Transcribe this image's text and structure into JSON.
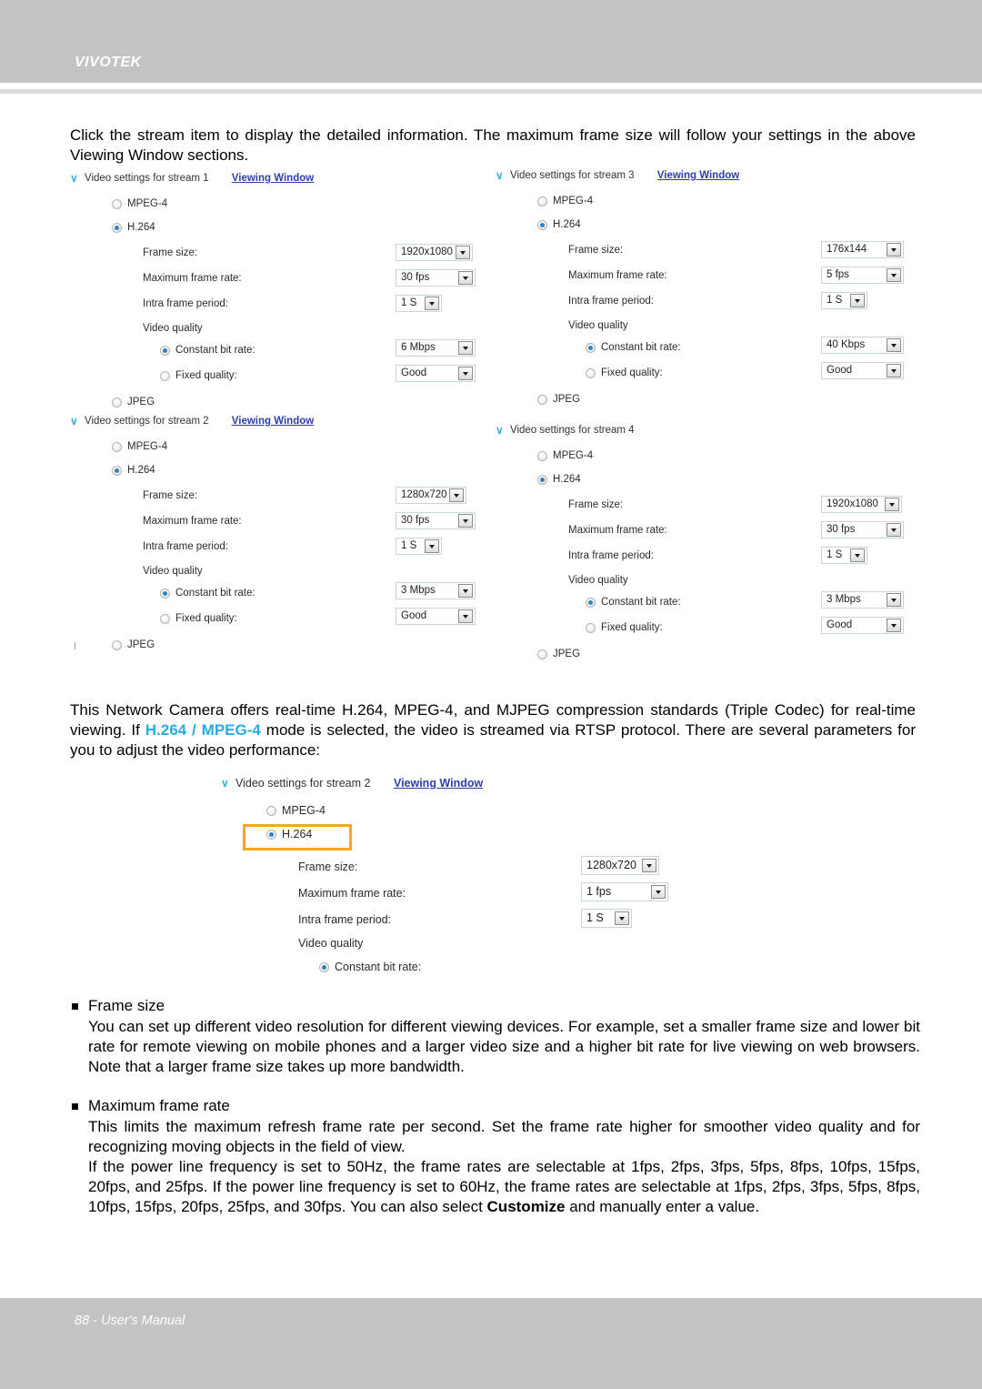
{
  "header": {
    "brand": "VIVOTEK"
  },
  "footer": {
    "page_text": "88 - User's Manual"
  },
  "intro_paragraph": "Click the stream item to display the detailed information. The maximum frame size will follow your settings in the above Viewing Window sections.",
  "codec_paragraph": {
    "part1": "This Network Camera offers real-time H.264, MPEG-4, and MJPEG compression standards (Triple Codec) for real-time viewing.  If ",
    "highlight": "H.264 / MPEG-4",
    "part2": " mode is selected, the video is streamed via RTSP protocol. There are several parameters for you to adjust the video performance:"
  },
  "labels": {
    "viewing_window": "Viewing Window",
    "mpeg4": "MPEG-4",
    "h264": "H.264",
    "jpeg": "JPEG",
    "frame_size": "Frame size:",
    "max_frame_rate": "Maximum frame rate:",
    "intra_frame_period": "Intra frame period:",
    "video_quality": "Video quality",
    "constant_bit_rate": "Constant bit rate:",
    "fixed_quality": "Fixed quality:"
  },
  "streams": [
    {
      "title": "Video settings for stream 1",
      "has_viewing_window": true,
      "frame_size": "1920x1080",
      "max_frame_rate": "30 fps",
      "intra_frame_period": "1 S",
      "constant_bit_rate": "6 Mbps",
      "fixed_quality": "Good"
    },
    {
      "title": "Video settings for stream 3",
      "has_viewing_window": true,
      "frame_size": "176x144",
      "max_frame_rate": "5 fps",
      "intra_frame_period": "1 S",
      "constant_bit_rate": "40 Kbps",
      "fixed_quality": "Good"
    },
    {
      "title": "Video settings for stream 2",
      "has_viewing_window": true,
      "frame_size": "1280x720",
      "max_frame_rate": "30 fps",
      "intra_frame_period": "1 S",
      "constant_bit_rate": "3 Mbps",
      "fixed_quality": "Good"
    },
    {
      "title": "Video settings for stream 4",
      "has_viewing_window": false,
      "frame_size": "1920x1080",
      "max_frame_rate": "30 fps",
      "intra_frame_period": "1 S",
      "constant_bit_rate": "3 Mbps",
      "fixed_quality": "Good"
    }
  ],
  "detail_panel": {
    "title": "Video settings for stream 2",
    "frame_size": "1280x720",
    "max_frame_rate": "1 fps",
    "intra_frame_period": "1 S"
  },
  "sections": [
    {
      "heading": "Frame size",
      "body": "You can set up different video resolution for different viewing devices. For example, set a smaller frame size and lower bit rate for remote viewing on mobile phones and a larger video size and a higher bit rate for live viewing on web browsers. Note that a larger frame size takes up more bandwidth."
    },
    {
      "heading": "Maximum frame rate",
      "body_line1": "This limits the maximum refresh frame rate per second. Set the frame rate higher for smoother video quality and for recognizing moving objects in the field of view.",
      "body_line2_a": "If the power line frequency is set to 50Hz, the frame rates are selectable at 1fps, 2fps, 3fps, 5fps, 8fps, 10fps, 15fps, 20fps, and 25fps. If the power line frequency is set to 60Hz, the frame rates are selectable at 1fps, 2fps, 3fps, 5fps, 8fps, 10fps, 15fps, 20fps, 25fps, and 30fps. You can also select ",
      "body_line2_bold": "Customize",
      "body_line2_b": " and manually enter a value."
    }
  ],
  "colors": {
    "band": "#c2c4c4",
    "cyan_highlight": "#29abe2",
    "link": "#2e3ea8",
    "highlight_border": "#f5a623",
    "radio_dot": "#2b83c4"
  }
}
